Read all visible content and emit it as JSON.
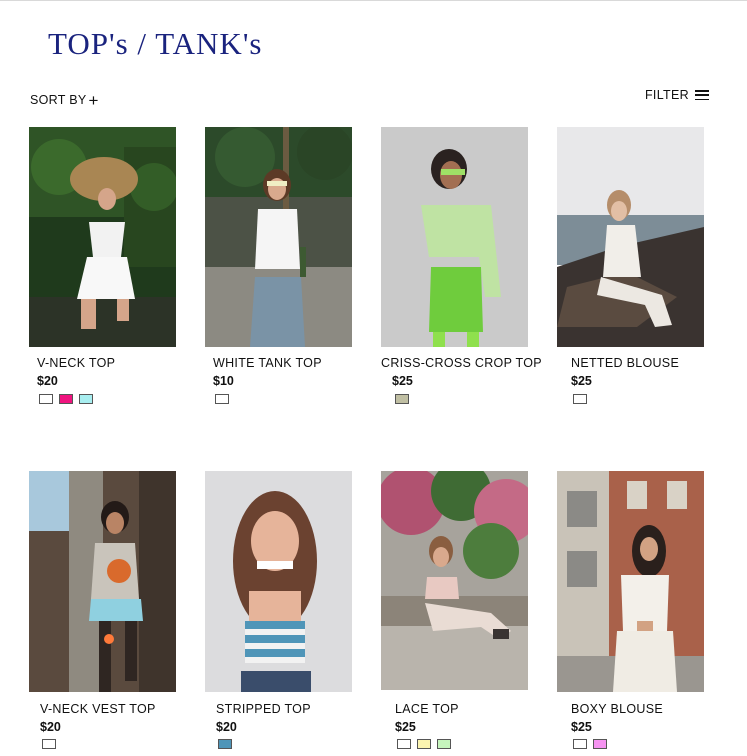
{
  "page": {
    "title": "TOP's / TANK's"
  },
  "toolbar": {
    "sort_label": "SORT BY",
    "sort_plus": "+",
    "filter_label": "FILTER"
  },
  "products": [
    {
      "name": "V-NECK TOP",
      "price": "$20",
      "swatches": [
        "#ffffff",
        "#f0147f",
        "#a8eef0"
      ],
      "image": "woman in white v-neck top with wide straw hat"
    },
    {
      "name": "WHITE TANK TOP",
      "price": "$10",
      "swatches": [
        "#ffffff"
      ],
      "image": "woman in white tank top and jeans holding a bottle"
    },
    {
      "name": "CRISS-CROSS CROP TOP",
      "price": "$25",
      "swatches": [
        "#c0bfa3"
      ],
      "image": "woman in green blazer crop top and green skirt"
    },
    {
      "name": "NETTED BLOUSE",
      "price": "$25",
      "swatches": [
        "#ffffff"
      ],
      "image": "woman in white netted outfit sitting on rocks by the sea"
    },
    {
      "name": "V-NECK VEST TOP",
      "price": "$20",
      "swatches": [
        "#ffffff"
      ],
      "image": "woman in grey graphic vest top and fishnets"
    },
    {
      "name": "STRIPPED TOP",
      "price": "$20",
      "swatches": [
        "#4f95b8"
      ],
      "image": "smiling woman in blue and white striped crop top"
    },
    {
      "name": "LACE TOP",
      "price": "$25",
      "swatches": [
        "#ffffff",
        "#fbf4b0",
        "#c6f5bd"
      ],
      "image": "woman in pink lace top sitting under flowering tree"
    },
    {
      "name": "BOXY BLOUSE",
      "price": "$25",
      "swatches": [
        "#ffffff",
        "#f593f0"
      ],
      "image": "woman in white boxy blouse in front of brick buildings"
    }
  ]
}
